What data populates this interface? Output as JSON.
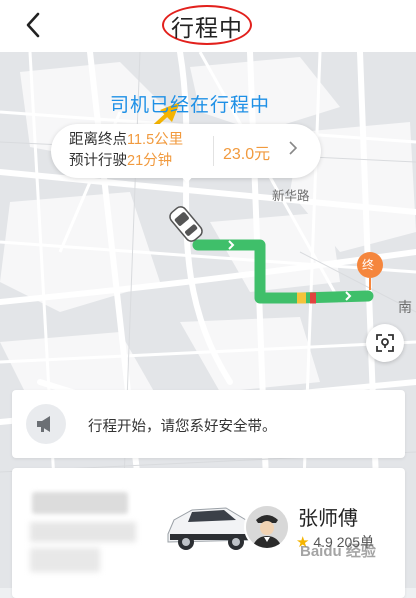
{
  "header": {
    "title": "行程中",
    "back_icon": "chevron-left-icon"
  },
  "annotation": {
    "text": "司机已经在行程中",
    "color": "#1e90e6",
    "arrow_color": "#f5b400",
    "circle_color": "#e2201c"
  },
  "trip_info": {
    "distance_prefix": "距离终点",
    "distance_value": "11.5公里",
    "time_prefix": "预计行驶",
    "time_value": "21分钟",
    "fare": "23.0元",
    "highlight_color": "#f19a3e"
  },
  "map": {
    "street_labels": [
      "新华路",
      "南"
    ],
    "destination_marker": "终",
    "route_color": "#3fbf6a",
    "marker_color": "#f5863d"
  },
  "notice": {
    "text": "行程开始，请您系好安全带。",
    "icon": "megaphone-icon"
  },
  "driver": {
    "name": "张师傅",
    "rating": "4.9",
    "orders": "205单"
  },
  "watermark": "Baidu 经验"
}
